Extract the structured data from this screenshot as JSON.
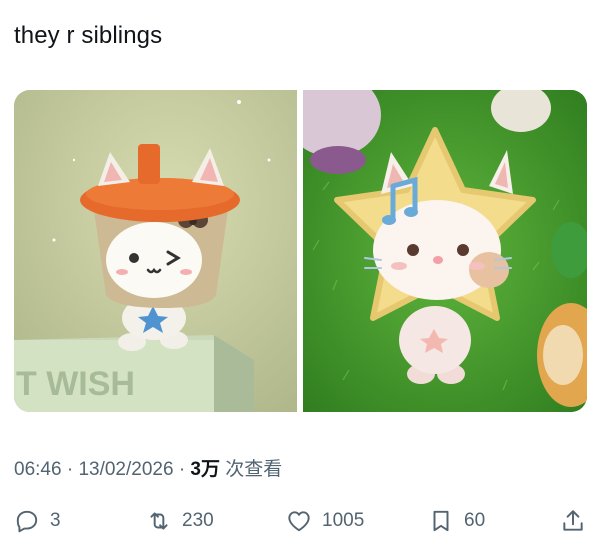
{
  "post": {
    "text": "they r siblings"
  },
  "media": {
    "left_image": {
      "sign_text": "T WISH"
    },
    "right_image": {}
  },
  "meta": {
    "time": "06:46",
    "sep1": "·",
    "date": "13/02/2026",
    "sep2": "·",
    "views_count": "3万",
    "views_label": "次查看"
  },
  "actions": {
    "reply_count": "3",
    "repost_count": "230",
    "like_count": "1005",
    "bookmark_count": "60"
  },
  "icons": {
    "reply": "reply-icon",
    "repost": "repost-icon",
    "like": "heart-icon",
    "bookmark": "bookmark-icon",
    "share": "share-icon"
  },
  "colors": {
    "text": "#0f1419",
    "muted": "#536471",
    "background": "#ffffff"
  }
}
